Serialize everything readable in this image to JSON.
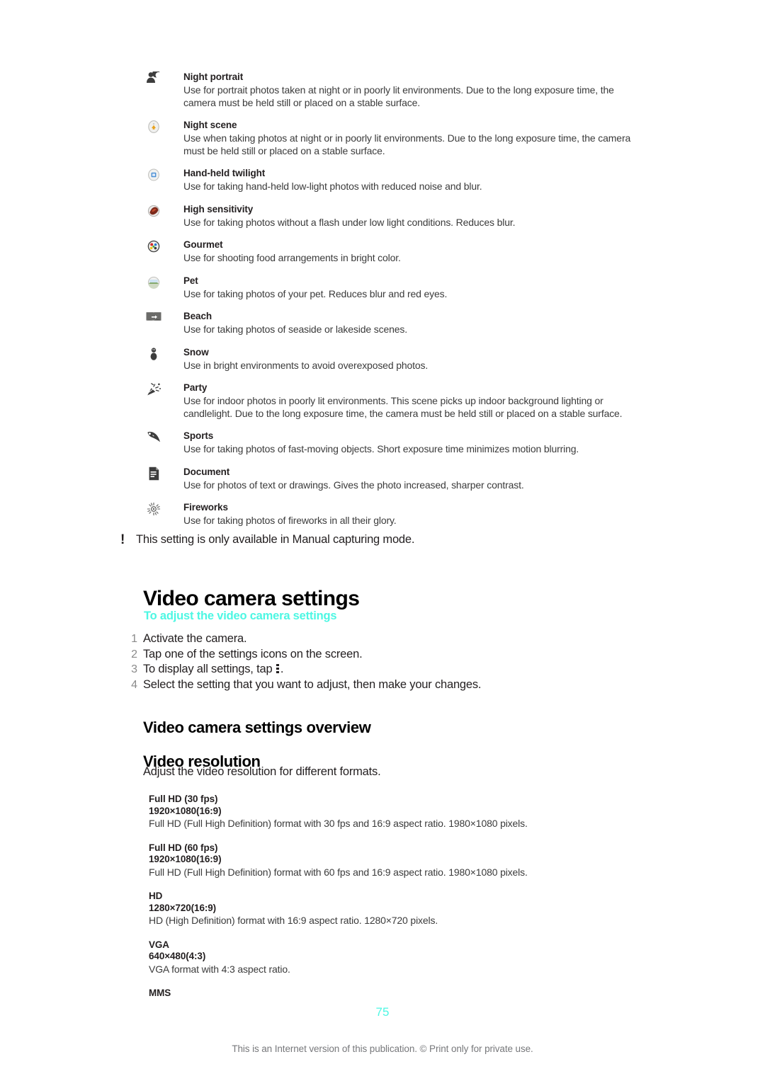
{
  "accent_color": "#4DF7E3",
  "page_number": "75",
  "footer_note": "This is an Internet version of this publication. © Print only for private use.",
  "scene_modes": [
    {
      "icon": "night-portrait-icon",
      "title": "Night portrait",
      "description": "Use for portrait photos taken at night or in poorly lit environments. Due to the long exposure time, the camera must be held still or placed on a stable surface."
    },
    {
      "icon": "night-scene-icon",
      "title": "Night scene",
      "description": "Use when taking photos at night or in poorly lit environments. Due to the long exposure time, the camera must be held still or placed on a stable surface."
    },
    {
      "icon": "hand-held-twilight-icon",
      "title": "Hand-held twilight",
      "description": "Use for taking hand-held low-light photos with reduced noise and blur."
    },
    {
      "icon": "high-sensitivity-icon",
      "title": "High sensitivity",
      "description": "Use for taking photos without a flash under low light conditions. Reduces blur."
    },
    {
      "icon": "gourmet-icon",
      "title": "Gourmet",
      "description": "Use for shooting food arrangements in bright color."
    },
    {
      "icon": "pet-icon",
      "title": "Pet",
      "description": "Use for taking photos of your pet. Reduces blur and red eyes."
    },
    {
      "icon": "beach-icon",
      "title": "Beach",
      "description": "Use for taking photos of seaside or lakeside scenes."
    },
    {
      "icon": "snow-icon",
      "title": "Snow",
      "description": "Use in bright environments to avoid overexposed photos."
    },
    {
      "icon": "party-icon",
      "title": "Party",
      "description": "Use for indoor photos in poorly lit environments. This scene picks up indoor background lighting or candlelight. Due to the long exposure time, the camera must be held still or placed on a stable surface."
    },
    {
      "icon": "sports-icon",
      "title": "Sports",
      "description": "Use for taking photos of fast-moving objects. Short exposure time minimizes motion blurring."
    },
    {
      "icon": "document-icon",
      "title": "Document",
      "description": "Use for photos of text or drawings. Gives the photo increased, sharper contrast."
    },
    {
      "icon": "fireworks-icon",
      "title": "Fireworks",
      "description": "Use for taking photos of fireworks in all their glory."
    }
  ],
  "note": {
    "marker": "!",
    "text": "This setting is only available in Manual capturing mode."
  },
  "video_camera_settings": {
    "heading": "Video camera settings",
    "procedure_heading": "To adjust the video camera settings",
    "steps": [
      {
        "number": "1",
        "text_before": "Activate the camera.",
        "text_after": ""
      },
      {
        "number": "2",
        "text_before": "Tap one of the settings icons on the screen.",
        "text_after": ""
      },
      {
        "number": "3",
        "text_before": "To display all settings, tap ",
        "text_after": "."
      },
      {
        "number": "4",
        "text_before": "Select the setting that you want to adjust, then make your changes.",
        "text_after": ""
      }
    ],
    "overview_heading": "Video camera settings overview",
    "video_resolution_heading": "Video resolution",
    "video_resolution_lead": "Adjust the video resolution for different formats.",
    "resolutions": [
      {
        "term": "Full HD (30 fps)",
        "dimensions": "1920×1080(16:9)",
        "description": "Full HD (Full High Definition) format with 30 fps and 16:9 aspect ratio. 1980×1080 pixels."
      },
      {
        "term": "Full HD (60 fps)",
        "dimensions": "1920×1080(16:9)",
        "description": "Full HD (Full High Definition) format with 60 fps and 16:9 aspect ratio. 1980×1080 pixels."
      },
      {
        "term": "HD",
        "dimensions": "1280×720(16:9)",
        "description": "HD (High Definition) format with 16:9 aspect ratio. 1280×720 pixels."
      },
      {
        "term": "VGA",
        "dimensions": "640×480(4:3)",
        "description": "VGA format with 4:3 aspect ratio."
      },
      {
        "term": "MMS",
        "dimensions": "",
        "description": ""
      }
    ]
  }
}
